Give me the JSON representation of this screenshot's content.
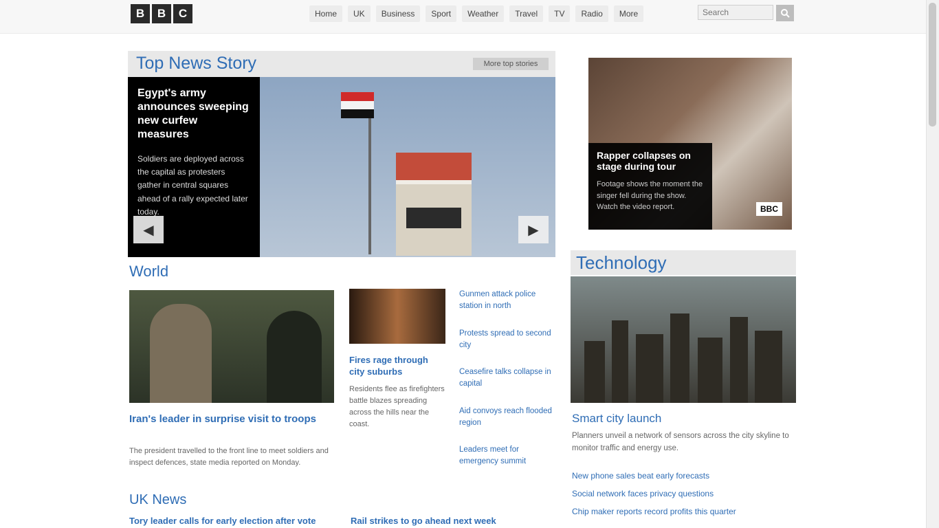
{
  "brand": {
    "logo": [
      "B",
      "B",
      "C"
    ]
  },
  "nav": {
    "items": [
      "Home",
      "UK",
      "Business",
      "Sport",
      "Weather",
      "Travel",
      "TV",
      "Radio",
      "More"
    ],
    "search_placeholder": "Search"
  },
  "top_news": {
    "title": "Top News Story",
    "more_label": "More top stories",
    "headline": "Egypt's army announces sweeping new curfew measures",
    "summary": "Soldiers are deployed across the capital as protesters gather in central squares ahead of a rally expected later today.",
    "controls": {
      "prev": "◀",
      "next": "▶"
    }
  },
  "video_card": {
    "title": "Rapper collapses on stage during tour",
    "summary": "Footage shows the moment the singer fell during the show. Watch the video report.",
    "badge": "BBC"
  },
  "world": {
    "section_title": "World",
    "main_headline": "Iran's leader in surprise visit to troops",
    "main_summary": "The president travelled to the front line to meet soldiers and inspect defences, state media reported on Monday.",
    "side_headline": "Fires rage through city suburbs",
    "side_summary": "Residents flee as firefighters battle blazes spreading across the hills near the coast.",
    "links": [
      "Gunmen attack police station in north",
      "Protests spread to second city",
      "Ceasefire talks collapse in capital",
      "Aid convoys reach flooded region",
      "Leaders meet for emergency summit"
    ]
  },
  "uk": {
    "section_title": "UK News",
    "link1": "Tory leader calls for early election after vote",
    "link2": "Rail strikes to go ahead next week"
  },
  "technology": {
    "section_title": "Technology",
    "headline": "Smart city launch",
    "summary": "Planners unveil a network of sensors across the city skyline to monitor traffic and energy use.",
    "links": [
      "New phone sales beat early forecasts",
      "Social network faces privacy questions",
      "Chip maker reports record profits this quarter"
    ]
  }
}
